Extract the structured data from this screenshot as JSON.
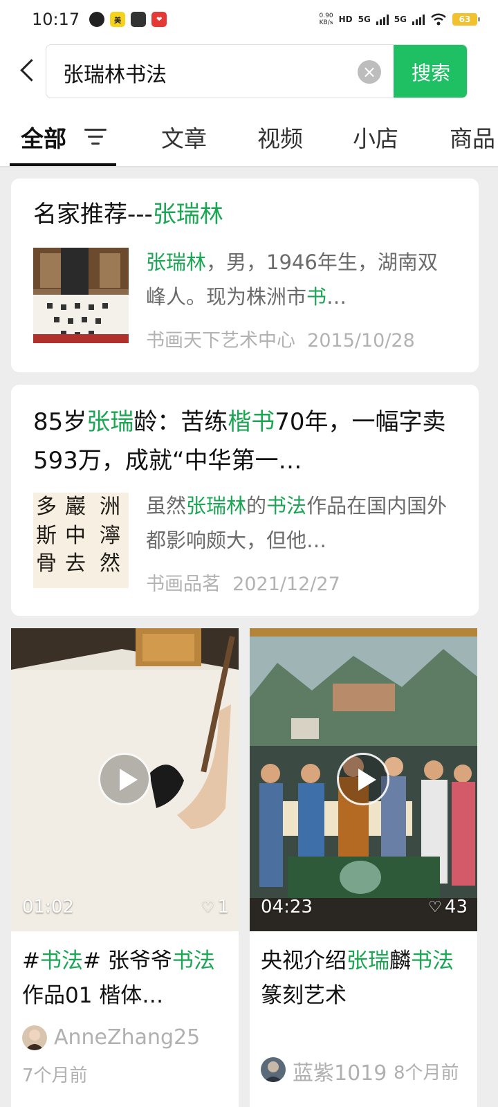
{
  "status_bar": {
    "time": "10:17",
    "net_speed_value": "0.90",
    "net_speed_unit": "KB/s",
    "hd_label": "HD",
    "signal1": "5G",
    "signal2": "5G",
    "battery": "63"
  },
  "search": {
    "query": "张瑞林书法",
    "button_label": "搜索"
  },
  "tabs": [
    {
      "label": "全部"
    },
    {
      "label": "文章"
    },
    {
      "label": "视频"
    },
    {
      "label": "小店"
    },
    {
      "label": "商品"
    }
  ],
  "results": [
    {
      "title_plain": "名家推荐---",
      "title_hl": "张瑞林",
      "summary_hl1": "张瑞林",
      "summary_text1": "，男，1946年生，湖南双峰人。现为株洲市",
      "summary_hl2": "书",
      "summary_ellipsis": "…",
      "source": "书画天下艺术中心",
      "date": "2015/10/28"
    },
    {
      "title_p1": "85岁",
      "title_h1": "张瑞",
      "title_p2": "龄：苦练",
      "title_h2": "楷书",
      "title_p3": "70年，一幅字卖593万，成就“中华第一…",
      "summary_p1": "虽然",
      "summary_h1": "张瑞林",
      "summary_p2": "的",
      "summary_h2": "书法",
      "summary_p3": "作品在国内国外都影响颇大，但他…",
      "source": "书画品茗",
      "date": "2021/12/27"
    }
  ],
  "videos": [
    {
      "duration": "01:02",
      "likes": "1",
      "title_p1": "#",
      "title_h1": "书法",
      "title_p2": "# 张爷爷",
      "title_h2": "书法",
      "title_p3": "作品01 楷体…",
      "author": "AnneZhang25",
      "time": "7个月前"
    },
    {
      "duration": "04:23",
      "likes": "43",
      "title_p1": "央视介绍",
      "title_h1": "张瑞",
      "title_p2": "麟",
      "title_h2": "书法",
      "title_p3": "篆刻艺术",
      "author": "蓝紫1019",
      "time": "8个月前"
    }
  ],
  "colors": {
    "accent": "#1fbf64",
    "highlight": "#1aa653"
  }
}
